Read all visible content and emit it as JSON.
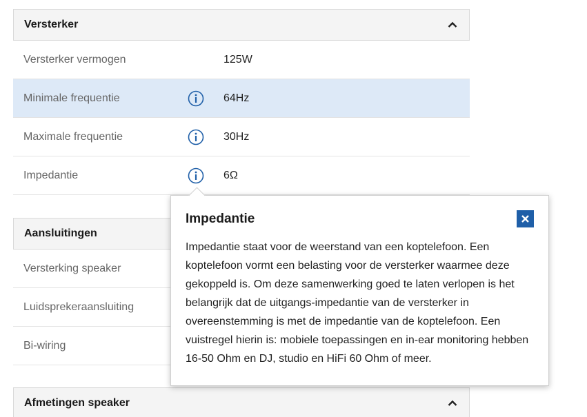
{
  "sections": {
    "versterker": {
      "title": "Versterker",
      "rows": [
        {
          "label": "Versterker vermogen",
          "value": "125W"
        },
        {
          "label": "Minimale frequentie",
          "value": "64Hz"
        },
        {
          "label": "Maximale frequentie",
          "value": "30Hz"
        },
        {
          "label": "Impedantie",
          "value": "6Ω"
        }
      ]
    },
    "aansluitingen": {
      "title": "Aansluitingen",
      "rows": [
        {
          "label": "Versterking speaker"
        },
        {
          "label": "Luidsprekeraansluiting"
        },
        {
          "label": "Bi-wiring"
        }
      ]
    },
    "afmetingen": {
      "title": "Afmetingen speaker"
    }
  },
  "tooltip": {
    "title": "Impedantie",
    "body": "Impedantie staat voor de weerstand van een koptelefoon. Een koptelefoon vormt een belasting voor de versterker waarmee deze gekoppeld is. Om deze samenwerking goed te laten verlopen is het belangrijk dat de uitgangs-impedantie van de versterker in overeenstemming is met de impedantie van de koptelefoon. Een vuistregel hierin is: mobiele toepassingen en in-ear monitoring hebben 16-50 Ohm en DJ, studio en HiFi 60 Ohm of meer."
  },
  "icons": {
    "info": "info-circle-icon",
    "chevron": "chevron-up-icon",
    "close": "close-icon"
  },
  "colors": {
    "accent": "#1f5fa8",
    "highlight_row": "#dde9f7",
    "header_bg": "#f4f4f4"
  }
}
